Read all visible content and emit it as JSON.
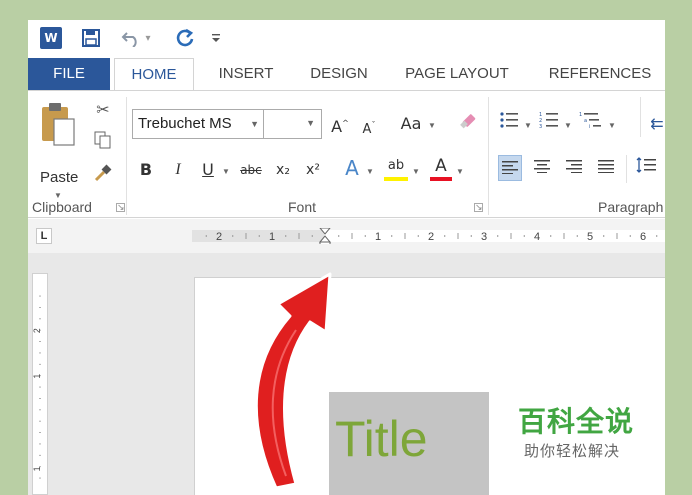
{
  "qat": {
    "word_logo": "W",
    "save_icon": "floppy-disk-icon",
    "undo_icon": "undo-icon",
    "redo_icon": "redo-icon"
  },
  "tabs": [
    {
      "label": "FILE"
    },
    {
      "label": "HOME",
      "active": true
    },
    {
      "label": "INSERT"
    },
    {
      "label": "DESIGN"
    },
    {
      "label": "PAGE LAYOUT"
    },
    {
      "label": "REFERENCES"
    }
  ],
  "ribbon": {
    "clipboard": {
      "paste_label": "Paste",
      "group_label": "Clipboard"
    },
    "font": {
      "font_name": "Trebuchet MS",
      "font_size": "",
      "group_label": "Font",
      "change_case": "Aa",
      "bold": "B",
      "italic": "I",
      "underline": "U",
      "strikethrough": "abc",
      "subscript": "x₂",
      "superscript": "x²",
      "text_effects": "A",
      "highlight": "ab",
      "font_color": "A",
      "font_color_value": "#e81123",
      "highlight_color_value": "#fff200"
    },
    "paragraph": {
      "group_label": "Paragraph"
    }
  },
  "ruler": {
    "tab_selector": "L",
    "horizontal_ticks": [
      "2",
      "1",
      "1",
      "2",
      "3",
      "4",
      "5",
      "6"
    ],
    "vertical_ticks": [
      "2",
      "1",
      "1"
    ]
  },
  "document": {
    "title_text": "Title",
    "title_color": "#7ea639"
  },
  "watermark": {
    "main": "百科全说",
    "sub": "助你轻松解决",
    "color": "#41a642"
  },
  "annotation": {
    "arrow_color": "#e01f1f"
  }
}
